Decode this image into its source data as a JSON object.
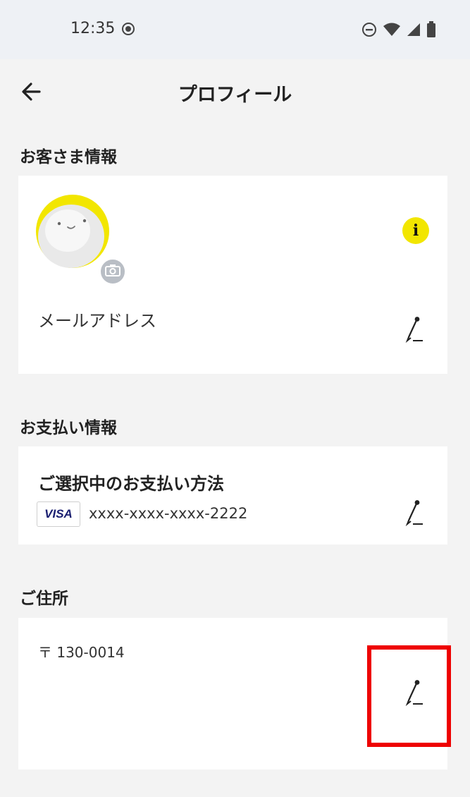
{
  "status_bar": {
    "time": "12:35",
    "icons": [
      "screen-record-icon",
      "do-not-disturb-icon",
      "wifi-icon",
      "signal-icon",
      "battery-icon"
    ]
  },
  "header": {
    "title": "プロフィール",
    "back_icon": "arrow-left-icon"
  },
  "customer_info": {
    "section_title": "お客さま情報",
    "email_label": "メールアドレス",
    "avatar_icon": "avatar-character-icon",
    "camera_icon": "camera-icon",
    "info_icon_glyph": "i"
  },
  "payment_info": {
    "section_title": "お支払い情報",
    "method_label": "ご選択中のお支払い方法",
    "card_brand": "VISA",
    "card_number": "xxxx-xxxx-xxxx-2222"
  },
  "address": {
    "section_title": "ご住所",
    "postal_code": "〒 130-0014"
  },
  "colors": {
    "accent_yellow": "#f2e600",
    "highlight_red": "#ee0000",
    "visa_blue": "#1a1f71"
  }
}
